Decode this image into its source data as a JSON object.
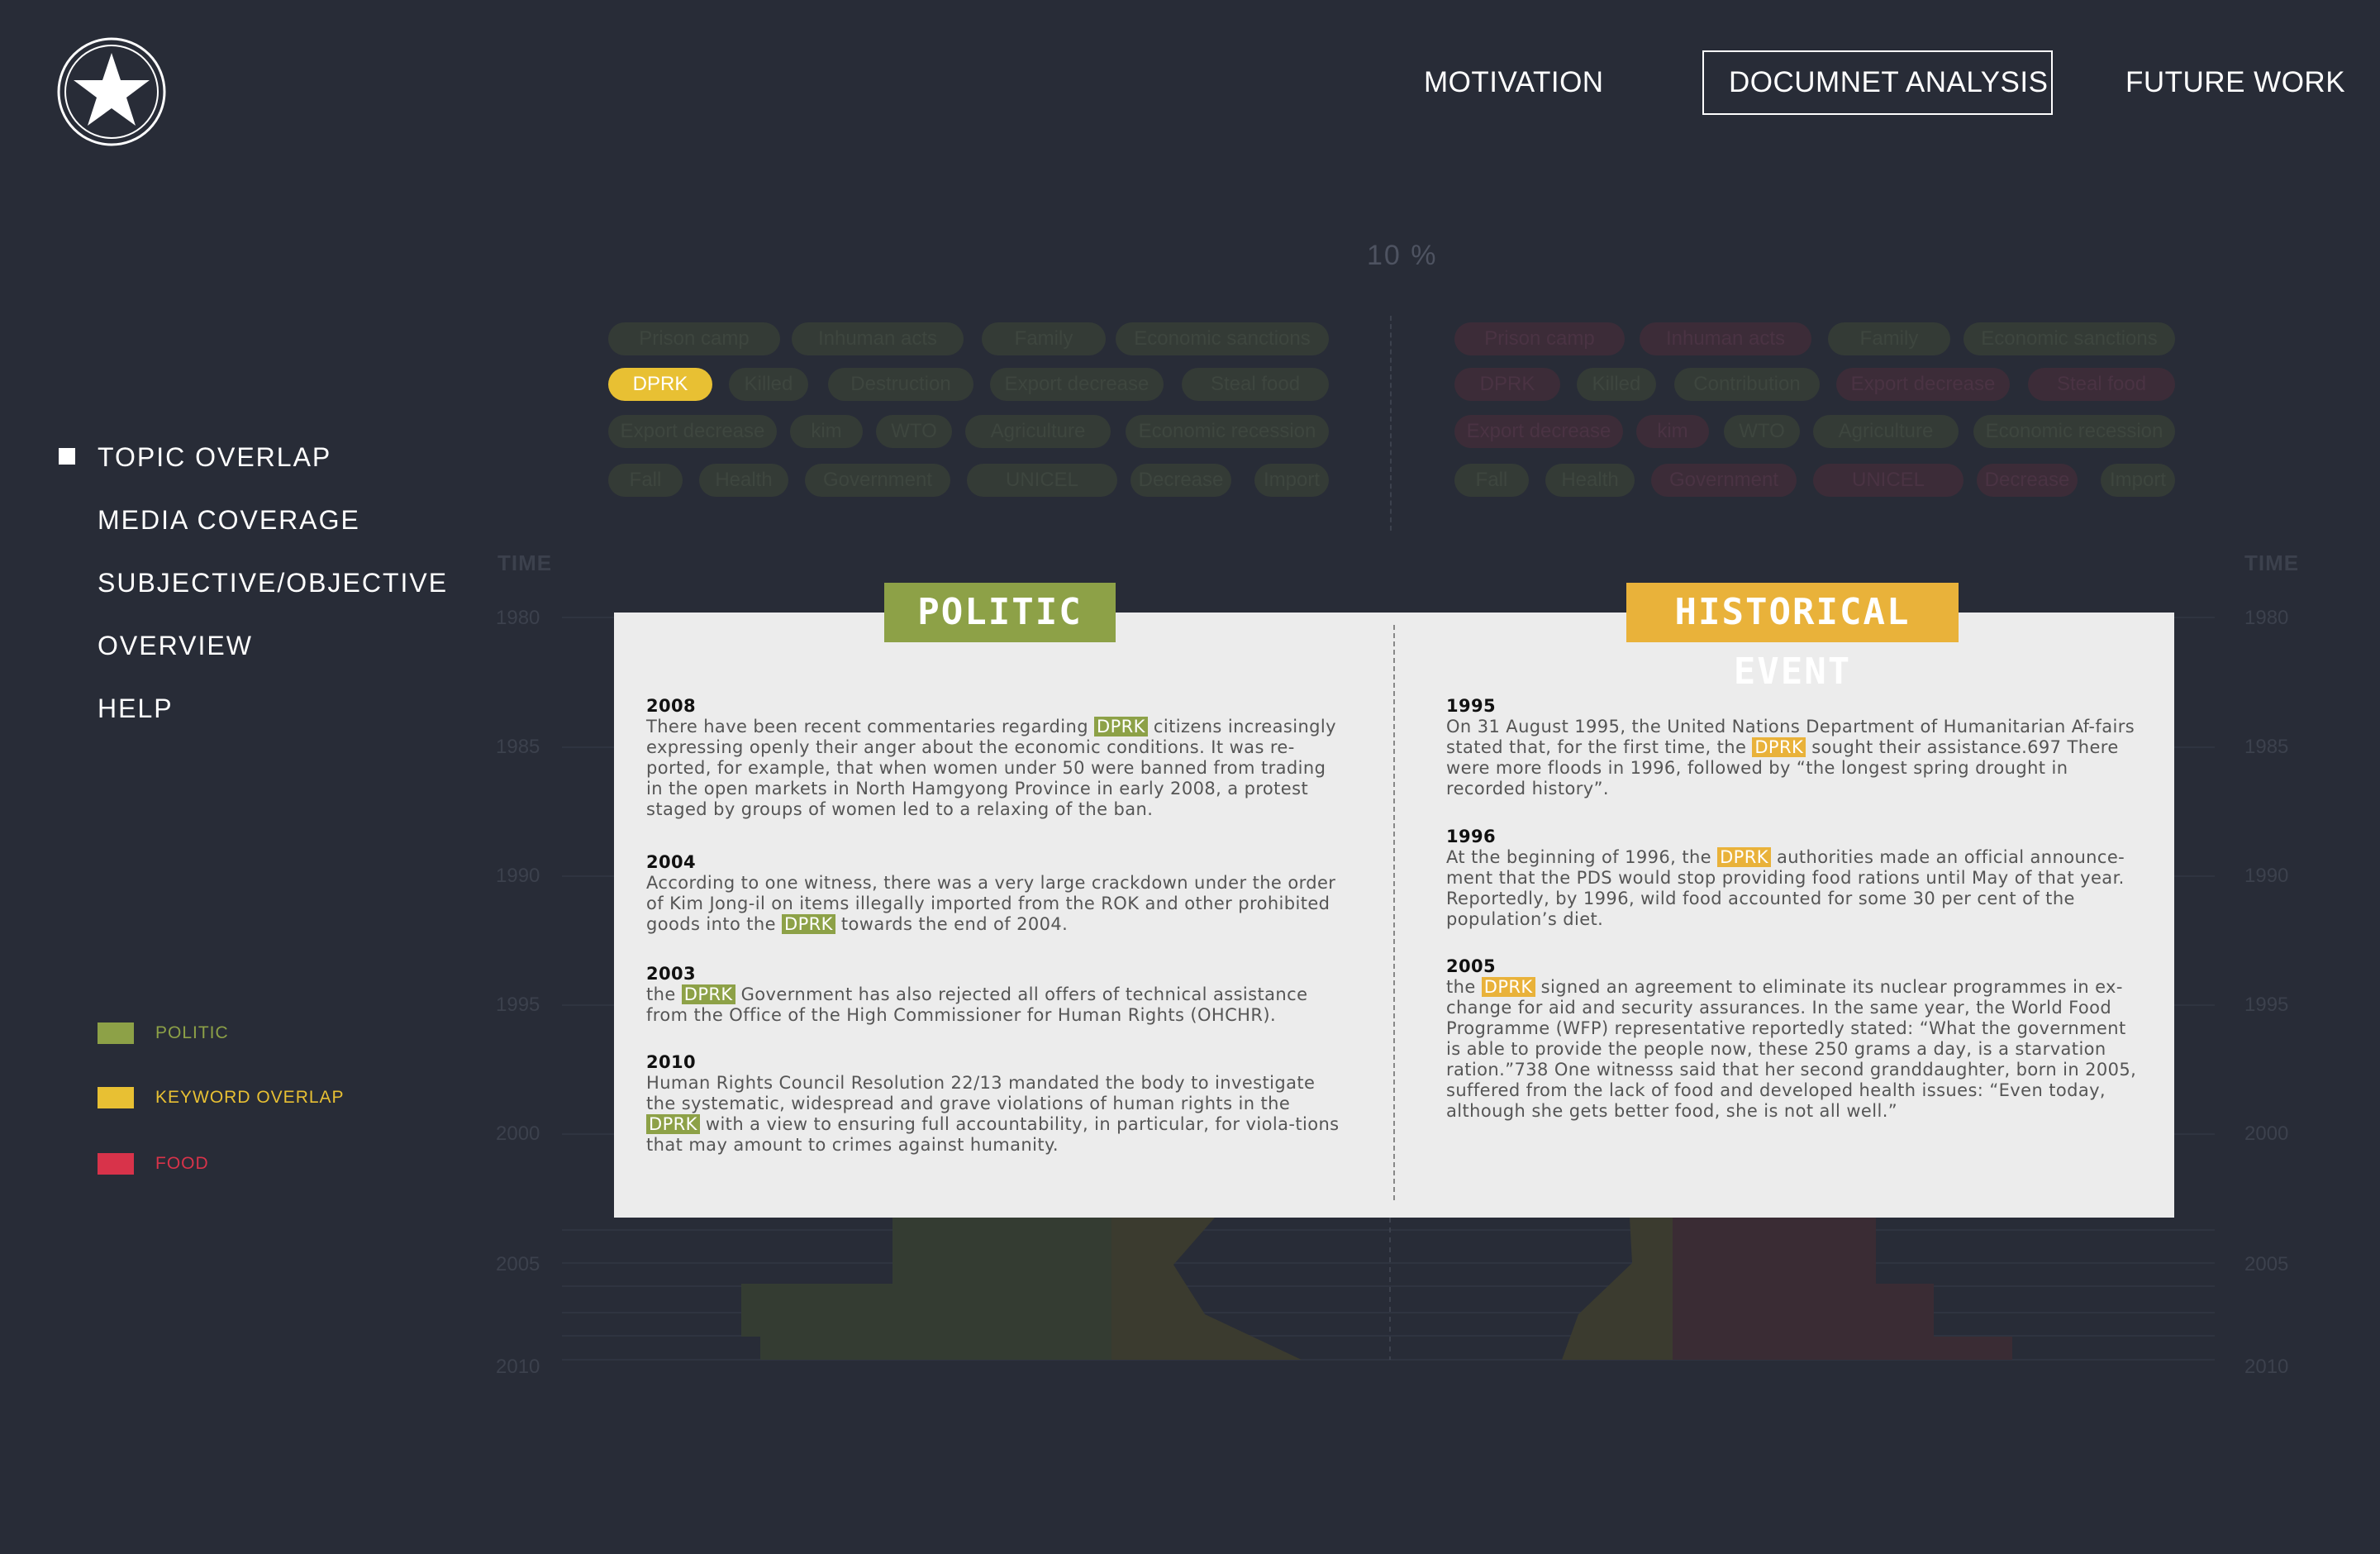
{
  "nav": {
    "motivation": "MOTIVATION",
    "analysis": "DOCUMNET ANALYSIS",
    "future": "FUTURE WORK"
  },
  "sidebar": {
    "items": [
      {
        "label": "TOPIC OVERLAP",
        "active": true
      },
      {
        "label": "MEDIA COVERAGE"
      },
      {
        "label": "SUBJECTIVE/OBJECTIVE"
      },
      {
        "label": "OVERVIEW"
      },
      {
        "label": "HELP"
      }
    ]
  },
  "legend": {
    "items": [
      {
        "label": "POLITIC",
        "color": "#8da147"
      },
      {
        "label": "KEYWORD OVERLAP",
        "color": "#e8c033"
      },
      {
        "label": "FOOD",
        "color": "#d8334a"
      }
    ]
  },
  "chart": {
    "percent_label": "10 %",
    "time_label": "TIME",
    "years": [
      "1980",
      "1985",
      "1990",
      "1995",
      "2000",
      "2005",
      "2010"
    ],
    "left_tags": [
      [
        "Prison camp",
        "Inhuman acts",
        "Family",
        "Economic sanctions"
      ],
      [
        "DPRK",
        "Killed",
        "Destruction",
        "Export decrease",
        "Steal food"
      ],
      [
        "Export decrease",
        "kim",
        "WTO",
        "Agriculture",
        "Economic recession"
      ],
      [
        "Fall",
        "Health",
        "Government",
        "UNICEL",
        "Decrease",
        "Import"
      ]
    ],
    "right_tags": [
      [
        "Prison camp",
        "Inhuman acts",
        "Family",
        "Economic sanctions"
      ],
      [
        "DPRK",
        "Killed",
        "Contribution",
        "Export decrease",
        "Steal food"
      ],
      [
        "Export decrease",
        "kim",
        "WTO",
        "Agriculture",
        "Economic recession"
      ],
      [
        "Fall",
        "Health",
        "Government",
        "UNICEL",
        "Decrease",
        "Import"
      ]
    ],
    "highlight_tag": "DPRK"
  },
  "panel": {
    "politic_title": "POLITIC",
    "historical_title": "HISTORICAL EVENT",
    "keyword": "DPRK",
    "politic": [
      {
        "year": "2008",
        "before": "There have been recent commentaries regarding ",
        "after": " citizens increasingly expressing openly their anger about the economic conditions. It was re-ported, for example, that when women under 50 were banned from trading in the open markets in North Hamgyong Province in early 2008, a protest staged by groups of women led to a relaxing of the ban."
      },
      {
        "year": "2004",
        "before": "According to one witness, there was a very large crackdown under the order of Kim Jong-il on items illegally imported from the ROK and other prohibited goods into the ",
        "after": " towards the end of 2004."
      },
      {
        "year": "2003",
        "before": "the ",
        "after": " Government has also rejected all offers of technical assistance from the Office of the High Commissioner for Human Rights (OHCHR)."
      },
      {
        "year": "2010",
        "before": "Human Rights Council Resolution 22/13 mandated the body to investigate the systematic, widespread and grave violations of human rights in the ",
        "after": "  with a view to ensuring full accountability, in particular, for viola-tions that may amount to crimes against humanity."
      }
    ],
    "historical": [
      {
        "year": "1995",
        "before": "On 31 August 1995, the United Nations Department of Humanitarian Af-fairs stated that, for the first time, the ",
        "after": " sought their assistance.697 There were more floods in 1996, followed by “the longest spring drought in recorded history”."
      },
      {
        "year": "1996",
        "before": "At the beginning of 1996, the ",
        "after": " authorities made an official announce-ment that the PDS would stop providing food rations until May of that year. Reportedly, by 1996, wild food accounted for some 30 per cent of the population’s diet."
      },
      {
        "year": "2005",
        "before": "the ",
        "after": " signed an agreement to eliminate its nuclear programmes in ex-change for aid and security assurances. In the same year, the World Food Programme (WFP) representative reportedly stated: “What the government is able to provide the people now, these 250 grams a day, is a starvation ration.”738 One witnesss said that her second granddaughter, born in 2005, suffered from the lack of food and developed health issues: “Even today, although she gets better food, she is not all well.”"
      }
    ]
  }
}
